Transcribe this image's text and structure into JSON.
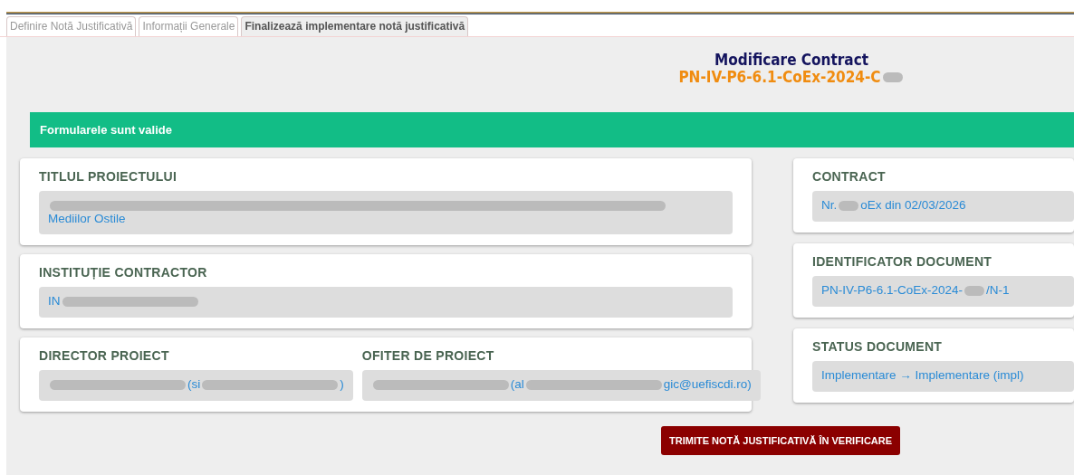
{
  "tabs": [
    {
      "label": "Definire Notă Justificativă",
      "selected": false
    },
    {
      "label": "Informații Generale",
      "selected": false
    },
    {
      "label": "Finalizează implementare notă justificativă",
      "selected": true
    }
  ],
  "header": {
    "title": "Modificare Contract",
    "subtitle": [
      {
        "kind": "text",
        "text": "PN-IV-P6-6.1-CoEx-2024-C"
      },
      {
        "kind": "redacted"
      }
    ]
  },
  "alert": {
    "text": "Formularele sunt valide"
  },
  "left_cards": [
    {
      "fields": [
        {
          "label": "TITLUL PROIECTULUI",
          "value": [
            {
              "kind": "redacted"
            },
            {
              "kind": "break"
            },
            {
              "kind": "text",
              "text": "Mediilor Ostile"
            }
          ]
        }
      ]
    },
    {
      "fields": [
        {
          "label": "INSTITUȚIE CONTRACTOR",
          "value": [
            {
              "kind": "text",
              "text": "IN"
            },
            {
              "kind": "redacted"
            }
          ]
        }
      ]
    },
    {
      "fields": [
        {
          "label": "DIRECTOR PROIECT",
          "value": [
            {
              "kind": "redacted"
            },
            {
              "kind": "text",
              "text": "(si"
            },
            {
              "kind": "redacted"
            },
            {
              "kind": "text",
              "text": ")"
            }
          ]
        },
        {
          "label": "OFITER DE PROIECT",
          "value": [
            {
              "kind": "redacted"
            },
            {
              "kind": "text",
              "text": "(al"
            },
            {
              "kind": "redacted"
            },
            {
              "kind": "text",
              "text": "gic@uefiscdi.ro)"
            }
          ]
        }
      ]
    }
  ],
  "right_cards": [
    {
      "label": "CONTRACT",
      "value": [
        {
          "kind": "text",
          "text": "Nr."
        },
        {
          "kind": "redacted"
        },
        {
          "kind": "text",
          "text": "oEx din 02/03/2026"
        }
      ]
    },
    {
      "label": "IDENTIFICATOR DOCUMENT",
      "value": [
        {
          "kind": "text",
          "text": "PN-IV-P6-6.1-CoEx-2024-"
        },
        {
          "kind": "redacted"
        },
        {
          "kind": "text",
          "text": "/N-1"
        }
      ]
    },
    {
      "label": "STATUS DOCUMENT",
      "value": [
        {
          "kind": "text",
          "text": "Implementare → Implementare (impl)"
        }
      ]
    }
  ],
  "submit_button": {
    "label": "TRIMITE NOTĂ JUSTIFICATIVĂ ÎN VERIFICARE"
  }
}
